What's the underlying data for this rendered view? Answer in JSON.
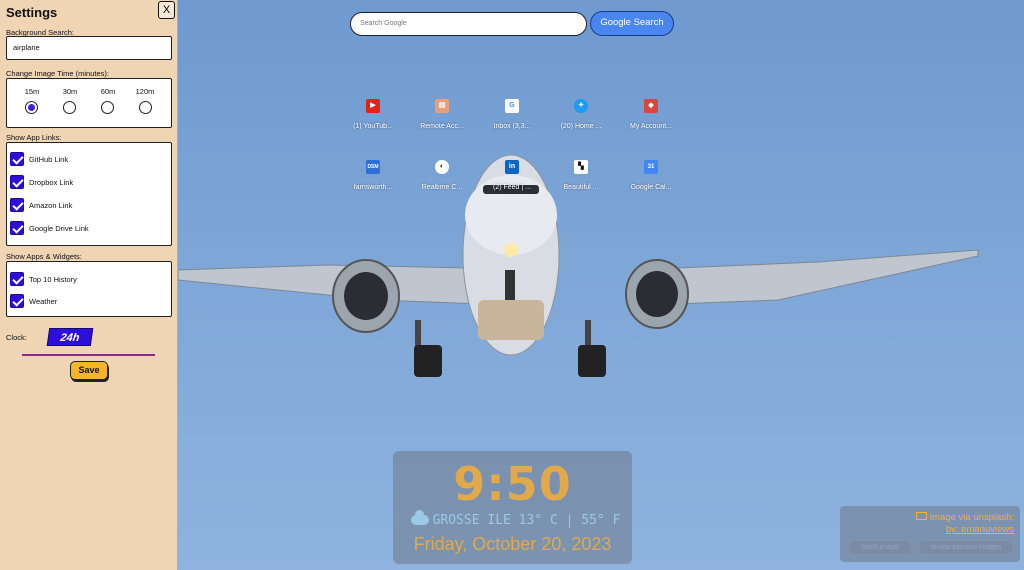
{
  "colors": {
    "accent": "#2d0fd9",
    "save": "#f4b52b",
    "clock_text": "#e2a94b",
    "weather_text": "#9cc9e6",
    "panel": "#f0d5b5"
  },
  "settings": {
    "title": "Settings",
    "close_label": "X",
    "bg_search_label": "Background Search:",
    "bg_search_value": "airplane",
    "image_time_label": "Change Image Time (minutes):",
    "image_time_options": [
      "15m",
      "30m",
      "60m",
      "120m"
    ],
    "image_time_selected": "15m",
    "app_links_label": "Show App Links:",
    "app_links": [
      {
        "label": "GitHub Link",
        "checked": true
      },
      {
        "label": "Dropbox Link",
        "checked": true
      },
      {
        "label": "Amazon Link",
        "checked": true
      },
      {
        "label": "Google Drive Link",
        "checked": true
      }
    ],
    "widgets_label": "Show Apps & Widgets:",
    "widgets": [
      {
        "label": "Top 10 History",
        "checked": true
      },
      {
        "label": "Weather",
        "checked": true
      }
    ],
    "clock_label": "Clock:",
    "clock_value": "24h",
    "save_label": "Save"
  },
  "search": {
    "placeholder": "Search Google",
    "button_label": "Google Search"
  },
  "shortcuts": [
    {
      "label": "(1) YouTub...",
      "icon": "youtube-icon",
      "color": "#e62117",
      "glyph": "▶"
    },
    {
      "label": "Remote Acc...",
      "icon": "remote-access-icon",
      "color": "#e8a07a",
      "glyph": "▤"
    },
    {
      "label": "Inbox (3,3...",
      "icon": "gmail-icon",
      "color": "#ffffff",
      "glyph": "G"
    },
    {
      "label": "(20) Home ...",
      "icon": "twitter-icon",
      "color": "#1d9bf0",
      "glyph": "✦"
    },
    {
      "label": "My Account...",
      "icon": "account-icon",
      "color": "#d9463b",
      "glyph": "◆"
    },
    {
      "label": "farnsworth...",
      "icon": "dsm-icon",
      "color": "#2f6fd6",
      "glyph": "DSM"
    },
    {
      "label": "Realtime C...",
      "icon": "realtime-icon",
      "color": "#ffffff",
      "glyph": "◐"
    },
    {
      "label": "(2) Feed | ...",
      "icon": "linkedin-icon",
      "color": "#0a66c2",
      "glyph": "in"
    },
    {
      "label": "Beautiful ...",
      "icon": "unsplash-icon",
      "color": "#ffffff",
      "glyph": "▚"
    },
    {
      "label": "Google Cal...",
      "icon": "calendar-icon",
      "color": "#4285f4",
      "glyph": "31"
    }
  ],
  "clock": {
    "time": "9:50",
    "weather": "GROSSE ILE 13° C | 55° F",
    "date": "Friday, October 20, 2023"
  },
  "attribution": {
    "line1": "image via unsplash:",
    "line2": "by: emanuviews",
    "block_label": "block image",
    "review_label": "review blocked images"
  }
}
